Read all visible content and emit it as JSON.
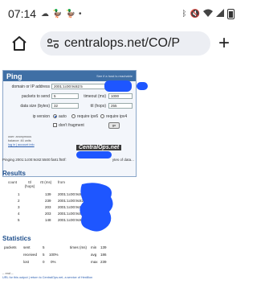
{
  "status_bar": {
    "time": "07:14",
    "left_icons": [
      "cloud-icon",
      "duck-icon",
      "duck-icon",
      "dot-icon"
    ],
    "right_icons": [
      "bluetooth-icon",
      "mute-icon",
      "wifi-icon",
      "signal-icon",
      "battery-icon"
    ]
  },
  "browser": {
    "url_display": "centralops.net/CO/P"
  },
  "ping_box": {
    "title": "Ping",
    "subtitle": "See if a host is reachable",
    "fields": {
      "domain_label": "domain or IP address",
      "domain_value": "2001:1c00:9c82:5",
      "packets_label": "packets to send",
      "packets_value": "5",
      "timeout_label": "timeout (ms)",
      "timeout_value": "1000",
      "datasize_label": "data size (bytes)",
      "datasize_value": "32",
      "ttl_label": "ttl (hops)",
      "ttl_value": "255",
      "ipversion_label": "ip version",
      "opt_auto": "auto",
      "opt_ipv6": "require ipv6",
      "opt_ipv4": "require ipv4",
      "dont_fragment": "don't fragment",
      "go_button": "go"
    },
    "user": {
      "user_line": "user: anonymous",
      "balance_line": "balance: 46 units",
      "login_link": "log in | account info"
    },
    "logo_text": "CentralOps.net"
  },
  "pinging_line": "Pinging 2001:1c00:9c82:5500:fa81:f50f:",
  "pinging_suffix": "ytes of data...",
  "results": {
    "heading": "Results",
    "columns": [
      "count",
      "ttl (hops)",
      "rtt (ms)",
      "from"
    ],
    "rows": [
      {
        "count": "1",
        "rtt": "139",
        "from": "2001:1c00:9c82"
      },
      {
        "count": "2",
        "rtt": "239",
        "from": "2001:1c00:9c82"
      },
      {
        "count": "3",
        "rtt": "203",
        "from": "2001:1c00:9c82"
      },
      {
        "count": "4",
        "rtt": "203",
        "from": "2001:1c00:9c82"
      },
      {
        "count": "5",
        "rtt": "148",
        "from": "2001:1c00:9c82"
      }
    ]
  },
  "statistics": {
    "heading": "Statistics",
    "packets_label": "packets",
    "sent_label": "sent",
    "sent_value": "5",
    "received_label": "received",
    "received_value": "5",
    "received_pct": "100%",
    "lost_label": "lost",
    "lost_value": "0",
    "lost_pct": "0%",
    "times_label": "times (ms)",
    "min_label": "min",
    "min_value": "139",
    "avg_label": "avg",
    "avg_value": "186",
    "max_label": "max",
    "max_value": "239"
  },
  "footer": {
    "end": "-- end --",
    "url_line": "URL for this output | return to CentralOps.net, a service of Hexillion"
  }
}
